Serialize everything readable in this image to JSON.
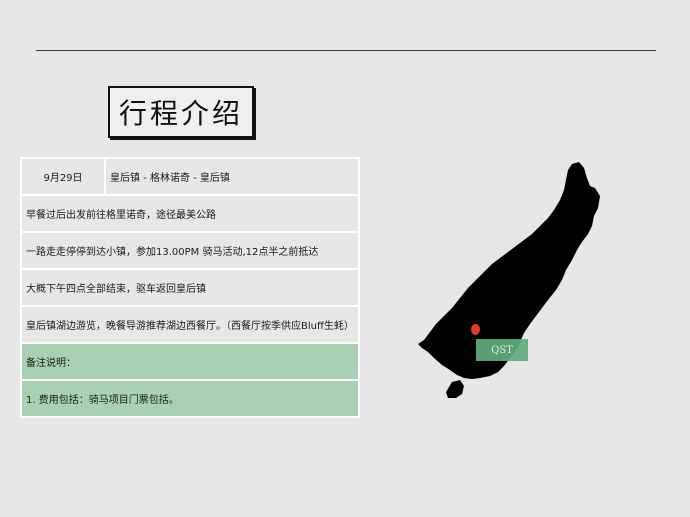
{
  "title": "行程介绍",
  "itinerary": {
    "header": {
      "date": "9月29日",
      "route": "皇后镇 - 格林诺奇 - 皇后镇"
    },
    "rows": [
      "早餐过后出发前往格里诺奇，途径最美公路",
      "一路走走停停到达小镇，参加13.00PM 骑马活动,12点半之前抵达",
      "大概下午四点全部结束，驱车返回皇后镇",
      "皇后镇湖边游览，晚餐导游推荐湖边西餐厅。（西餐厅按季供应Bluff生蚝）"
    ],
    "notes_title": "备注说明：",
    "notes": "1. 费用包括：骑马项目门票包括。"
  },
  "map": {
    "marker_label": "QST",
    "marker_color": "#e53935",
    "label_color": "#5fae7e",
    "land_color": "#000000"
  }
}
